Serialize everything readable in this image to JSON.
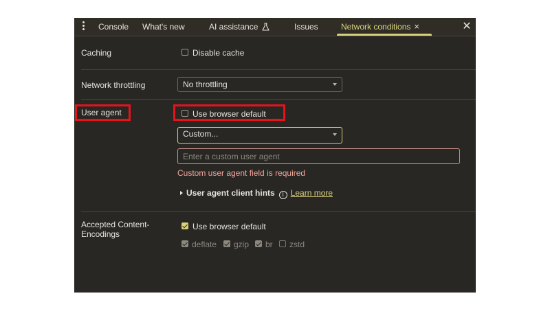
{
  "tabs": [
    {
      "label": "Console"
    },
    {
      "label": "What's new"
    },
    {
      "label": "AI assistance"
    },
    {
      "label": "Issues"
    },
    {
      "label": "Network conditions"
    }
  ],
  "tab_close_glyph": "×",
  "panel_close_glyph": "✕",
  "accent_color": "#d8d07a",
  "caching": {
    "label": "Caching",
    "disable_cache_label": "Disable cache",
    "disable_cache_checked": false
  },
  "throttling": {
    "label": "Network throttling",
    "selected": "No throttling"
  },
  "user_agent": {
    "label": "User agent",
    "use_default_label": "Use browser default",
    "use_default_checked": false,
    "selected": "Custom...",
    "input_placeholder": "Enter a custom user agent",
    "input_value": "",
    "error": "Custom user agent field is required",
    "client_hints_label": "User agent client hints",
    "learn_more": "Learn more"
  },
  "encodings": {
    "label": "Accepted Content-Encodings",
    "use_default_label": "Use browser default",
    "use_default_checked": true,
    "options": [
      {
        "label": "deflate",
        "checked": true
      },
      {
        "label": "gzip",
        "checked": true
      },
      {
        "label": "br",
        "checked": true
      },
      {
        "label": "zstd",
        "checked": false
      }
    ]
  }
}
